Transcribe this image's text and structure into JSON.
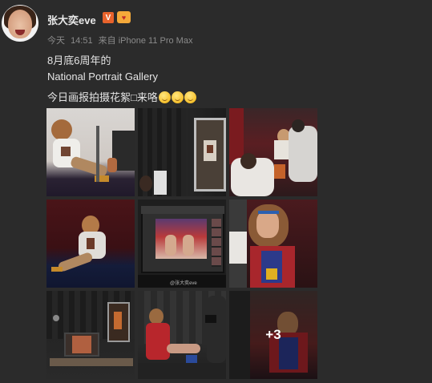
{
  "post": {
    "username": "张大奕eve",
    "badges": {
      "verified": "V",
      "vip": "♥"
    },
    "meta": {
      "day": "今天",
      "time": "14:51",
      "source": "来自 iPhone 11 Pro Max"
    },
    "text": {
      "line1": "8月底6周年的",
      "line2": "National Portrait Gallery",
      "line3": "今日画报拍摄花絮□来咯"
    },
    "emoji": [
      "grin-emoji",
      "grin-emoji",
      "grin-emoji"
    ],
    "images": {
      "count": 9,
      "more_label": "+3",
      "watermark": "@张大奕eve"
    }
  },
  "colors": {
    "background": "#2b2b2b",
    "text": "#e4e4e4",
    "meta": "#8b8b8b",
    "verified": "#e8632c",
    "vip": "#f4a93a"
  }
}
